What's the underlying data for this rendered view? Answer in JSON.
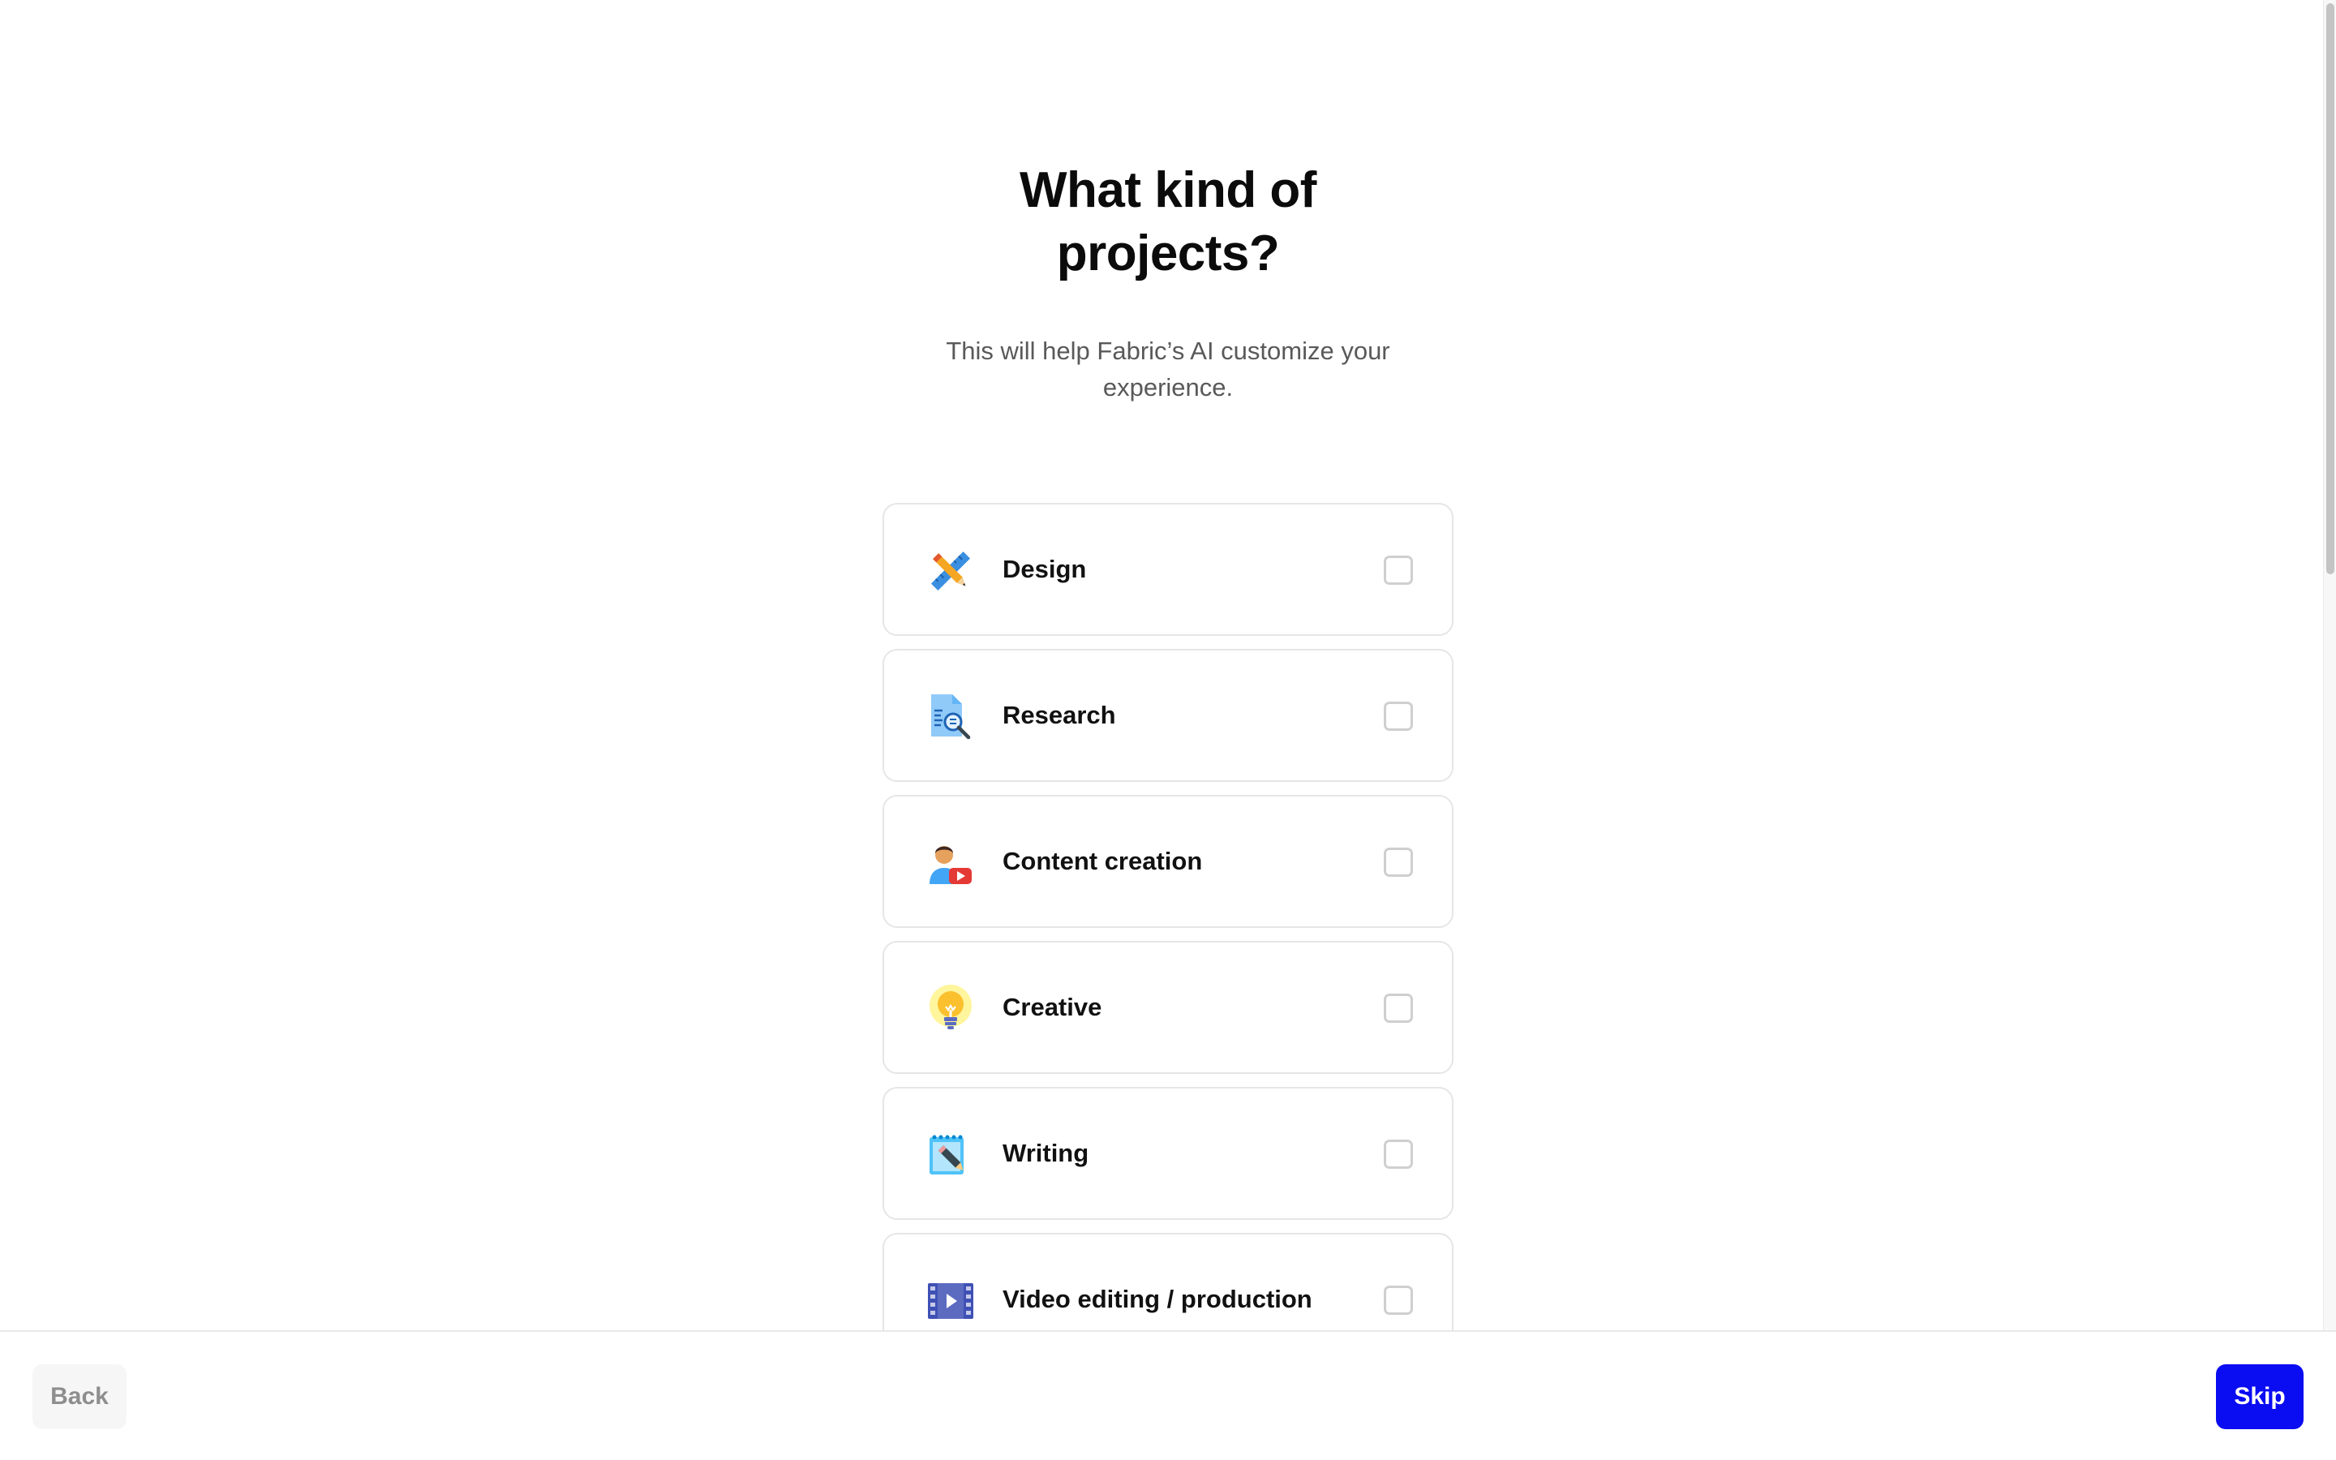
{
  "header": {
    "title_line1": "What kind of",
    "title_line2": "projects?",
    "subtitle": "This will help Fabric’s AI customize your experience."
  },
  "options": [
    {
      "label": "Design",
      "icon": "pencil-ruler-icon",
      "checked": false
    },
    {
      "label": "Research",
      "icon": "document-search-icon",
      "checked": false
    },
    {
      "label": "Content creation",
      "icon": "video-creator-icon",
      "checked": false
    },
    {
      "label": "Creative",
      "icon": "lightbulb-icon",
      "checked": false
    },
    {
      "label": "Writing",
      "icon": "notepad-pen-icon",
      "checked": false
    },
    {
      "label": "Video editing / production",
      "icon": "film-strip-icon",
      "checked": false
    }
  ],
  "footer": {
    "back_label": "Back",
    "skip_label": "Skip"
  },
  "colors": {
    "primary": "#0a0cf2",
    "card_border": "#e6e6e6",
    "subtitle_text": "#595959"
  }
}
